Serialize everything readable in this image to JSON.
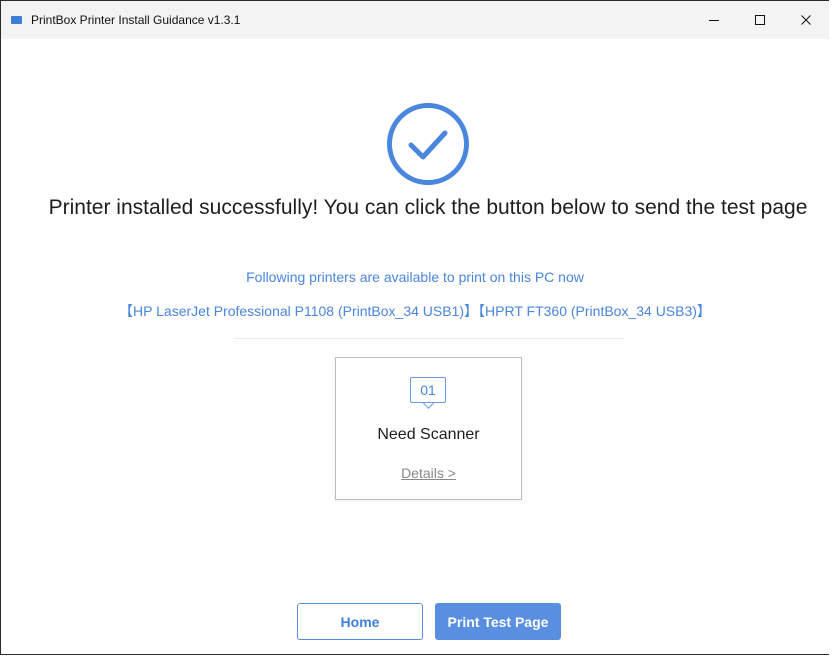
{
  "window": {
    "title": "PrintBox Printer Install Guidance v1.3.1",
    "icon": "app-printer-icon",
    "controls": {
      "minimize": "–",
      "maximize": "☐",
      "close": "✕"
    }
  },
  "main": {
    "status_icon": "success-check-icon",
    "headline": "Printer installed successfully! You can click the button below to send the test page",
    "available_label": "Following printers are available to print on this PC now",
    "printers_list": "【HP LaserJet Professional P1108 (PrintBox_34 USB1)】【HPRT FT360 (PrintBox_34 USB3)】",
    "card": {
      "number": "01",
      "title": "Need Scanner",
      "link": "Details >"
    }
  },
  "footer": {
    "home_label": "Home",
    "print_label": "Print Test Page"
  },
  "colors": {
    "accent": "#4a86dd",
    "button_fill": "#5a8fe0",
    "titlebar": "#f3f3f3"
  }
}
